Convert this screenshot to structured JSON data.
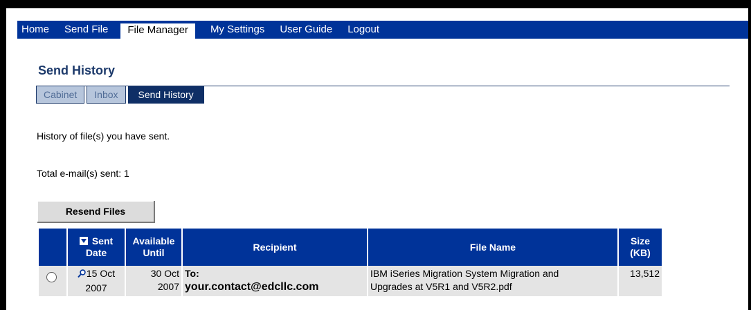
{
  "nav": {
    "items": [
      "Home",
      "Send File",
      "File Manager",
      "My Settings",
      "User Guide",
      "Logout"
    ],
    "active_index": 2
  },
  "page": {
    "title": "Send History",
    "subtabs": [
      "Cabinet",
      "Inbox",
      "Send History"
    ],
    "active_subtab": 2,
    "description": "History of file(s) you have sent.",
    "total_text": "Total e-mail(s) sent: 1"
  },
  "actions": {
    "resend_label": "Resend Files"
  },
  "table": {
    "headers": {
      "sent_line1": "Sent",
      "sent_line2": "Date",
      "available_line1": "Available",
      "available_line2": "Until",
      "recipient": "Recipient",
      "file_name": "File Name",
      "size_line1": "Size",
      "size_line2": "(KB)"
    },
    "rows": [
      {
        "sent_line1": "15 Oct",
        "sent_line2": "2007",
        "available_line1": "30 Oct",
        "available_line2": "2007",
        "recipient_prefix": "To:",
        "recipient_email": "your.contact@edcllc.com",
        "file_name_line1": "IBM iSeries Migration System Migration and",
        "file_name_line2": "Upgrades at V5R1 and V5R2.pdf",
        "size": "13,512",
        "selected": false
      }
    ]
  },
  "colors": {
    "nav_bg": "#003399",
    "title": "#1d3a6b",
    "subtab_active": "#0f2f66",
    "row_bg": "#e4e4e4"
  },
  "icons": {
    "sort": "sort-descending-icon",
    "view": "magnifier-icon"
  }
}
